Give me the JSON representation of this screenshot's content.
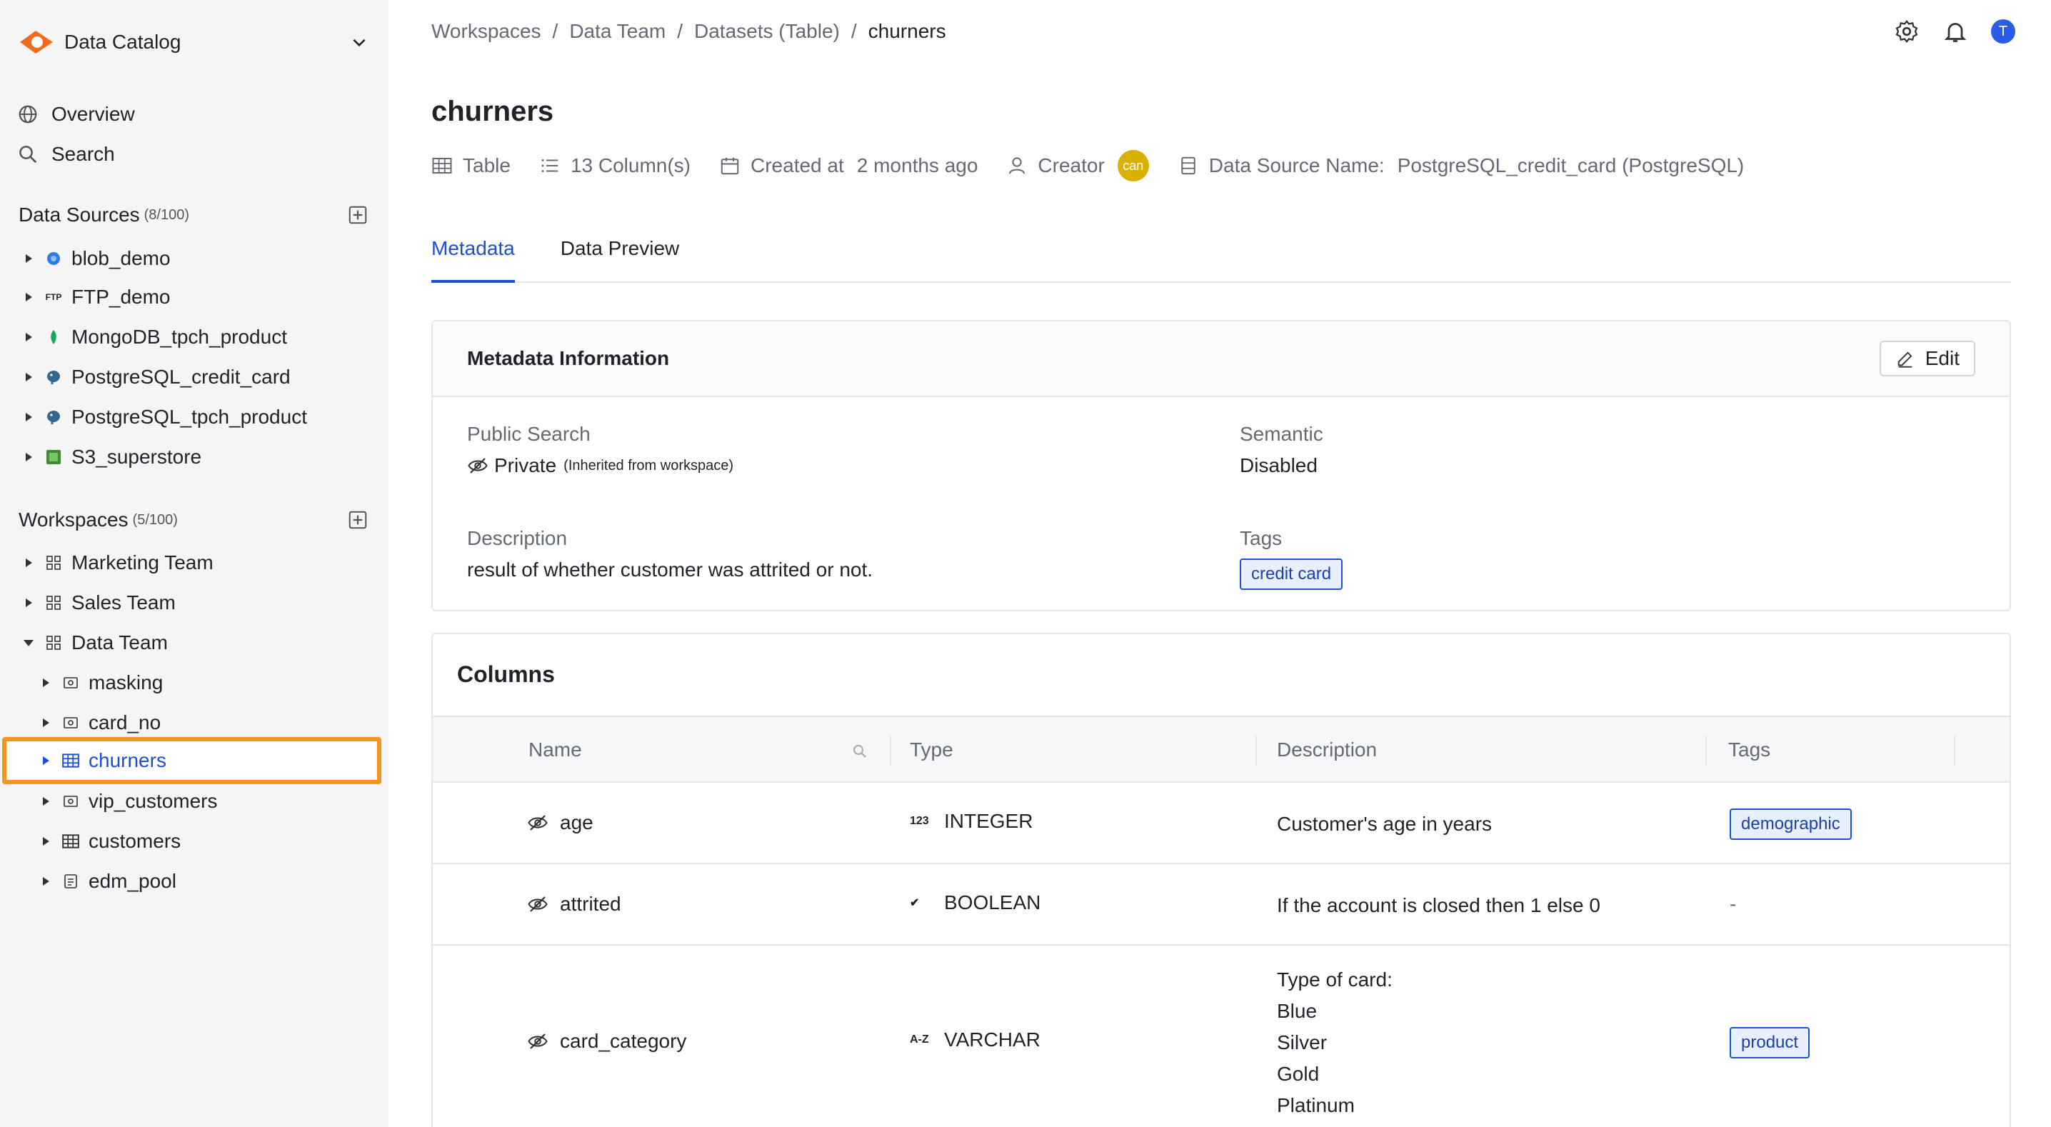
{
  "app": {
    "title": "Data Catalog"
  },
  "sidebar": {
    "nav": [
      {
        "label": "Overview",
        "icon": "globe-icon"
      },
      {
        "label": "Search",
        "icon": "search-icon"
      }
    ],
    "data_sources": {
      "label": "Data Sources",
      "count": "(8/100)",
      "items": [
        {
          "label": "blob_demo",
          "icon": "azure-blob-icon"
        },
        {
          "label": "FTP_demo",
          "icon": "ftp-icon"
        },
        {
          "label": "MongoDB_tpch_product",
          "icon": "mongodb-icon"
        },
        {
          "label": "PostgreSQL_credit_card",
          "icon": "postgresql-icon"
        },
        {
          "label": "PostgreSQL_tpch_product",
          "icon": "postgresql-icon"
        },
        {
          "label": "S3_superstore",
          "icon": "s3-icon"
        }
      ]
    },
    "workspaces": {
      "label": "Workspaces",
      "count": "(5/100)",
      "items": [
        {
          "label": "Marketing Team",
          "icon": "workspace-icon"
        },
        {
          "label": "Sales Team",
          "icon": "workspace-icon"
        },
        {
          "label": "Data Team",
          "icon": "workspace-icon",
          "expanded": true
        }
      ],
      "children": [
        {
          "label": "masking",
          "icon": "view-icon"
        },
        {
          "label": "card_no",
          "icon": "view-icon"
        },
        {
          "label": "churners",
          "icon": "table-icon",
          "selected": true
        },
        {
          "label": "vip_customers",
          "icon": "view-icon"
        },
        {
          "label": "customers",
          "icon": "table-icon"
        },
        {
          "label": "edm_pool",
          "icon": "file-icon"
        }
      ]
    }
  },
  "breadcrumb": [
    "Workspaces",
    "Data Team",
    "Datasets (Table)",
    "churners"
  ],
  "breadcrumb_sep": "/",
  "header": {
    "avatar_initial": "T"
  },
  "dataset": {
    "title": "churners",
    "type": "Table",
    "columns_count": "13 Column(s)",
    "created_label": "Created at",
    "created_value": "2 months ago",
    "creator_label": "Creator",
    "creator_avatar": "can",
    "datasource_label": "Data Source Name:",
    "datasource_value": "PostgreSQL_credit_card (PostgreSQL)"
  },
  "tabs": [
    {
      "label": "Metadata",
      "active": true
    },
    {
      "label": "Data Preview",
      "active": false
    }
  ],
  "metadata": {
    "title": "Metadata Information",
    "edit_label": "Edit",
    "public_search_label": "Public Search",
    "public_search_value": "Private",
    "public_search_note": "(Inherited from workspace)",
    "semantic_label": "Semantic",
    "semantic_value": "Disabled",
    "description_label": "Description",
    "description_value": "result of whether customer was attrited or not.",
    "tags_label": "Tags",
    "tags": [
      "credit card"
    ]
  },
  "columns": {
    "title": "Columns",
    "headers": [
      "Name",
      "Type",
      "Description",
      "Tags"
    ],
    "rows": [
      {
        "name": "age",
        "type_icon": "123",
        "type": "INTEGER",
        "description": [
          "Customer's age in years"
        ],
        "tag": "demographic"
      },
      {
        "name": "attrited",
        "type_icon": "✔",
        "type": "BOOLEAN",
        "description": [
          "If the account is closed then 1 else 0"
        ],
        "tag": "-"
      },
      {
        "name": "card_category",
        "type_icon": "A-Z",
        "type": "VARCHAR",
        "description": [
          "Type of card:",
          "Blue",
          "Silver",
          "Gold",
          "Platinum"
        ],
        "tag": "product"
      }
    ]
  },
  "colors": {
    "accent": "#1a4fd6",
    "highlight": "#f7941d",
    "logo": "#f26b1d",
    "sidebar_bg": "#f5f5f6"
  }
}
